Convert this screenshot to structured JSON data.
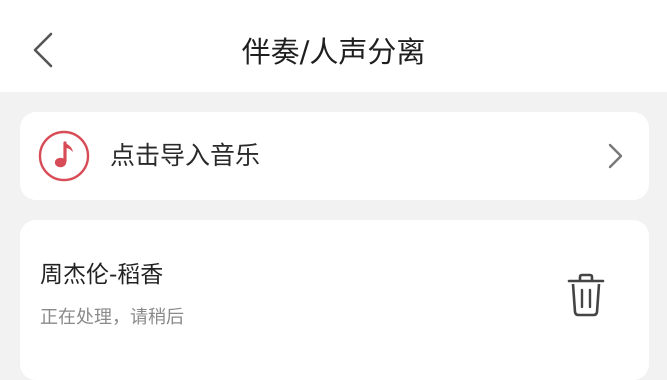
{
  "header": {
    "title": "伴奏/人声分离",
    "back_icon": "chevron-left-icon"
  },
  "import": {
    "label": "点击导入音乐",
    "icon": "music-note-icon",
    "accent_color": "#d84c57"
  },
  "task": {
    "title": "周杰伦-稻香",
    "status": "正在处理，请稍后",
    "delete_icon": "trash-icon"
  }
}
